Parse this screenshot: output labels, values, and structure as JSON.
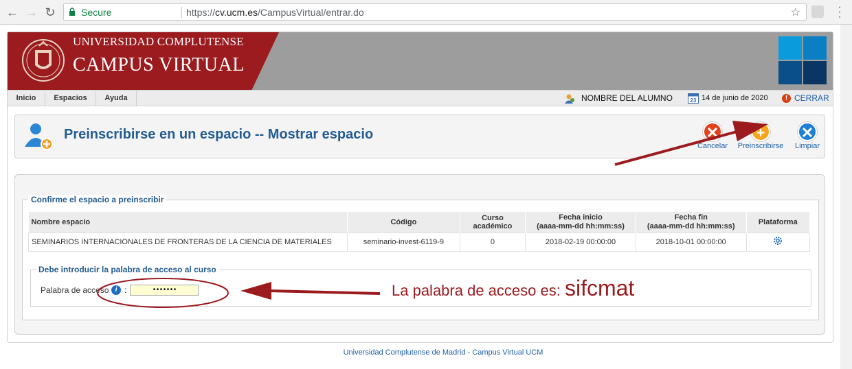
{
  "browser": {
    "secure_label": "Secure",
    "url_scheme": "https://",
    "url_host": "cv.ucm.es",
    "url_path": "/CampusVirtual/entrar.do"
  },
  "header": {
    "university": "UNIVERSIDAD COMPLUTENSE",
    "campus": "CAMPUS VIRTUAL",
    "tiles_colors": [
      "#0a9bdc",
      "#0b7fc4",
      "#0a4f87",
      "#0b3664"
    ],
    "brand_red": "#9b1b1f"
  },
  "navbar": {
    "items": [
      "Inicio",
      "Espacios",
      "Ayuda"
    ],
    "user_name": "NOMBRE DEL ALUMNO",
    "date": "14 de junio de 2020",
    "calendar_day": "23",
    "logout": "CERRAR"
  },
  "title_box": {
    "heading": "Preinscribirse en un espacio -- Mostrar espacio",
    "actions": {
      "cancel": "Cancelar",
      "preinscribe": "Preinscribirse",
      "clear": "Limpiar"
    }
  },
  "confirm": {
    "legend": "Confirme el espacio a preinscribir",
    "columns": {
      "name": "Nombre espacio",
      "code": "Código",
      "year": "Curso académico",
      "start_1": "Fecha inicio",
      "start_2": "(aaaa-mm-dd hh:mm:ss)",
      "end_1": "Fecha fin",
      "end_2": "(aaaa-mm-dd hh:mm:ss)",
      "platform": "Plataforma"
    },
    "row": {
      "name": "SEMINARIOS INTERNACIONALES DE FRONTERAS DE LA CIENCIA DE MATERIALES",
      "code": "seminario-invest-6119-9",
      "year": "0",
      "start": "2018-02-19 00:00:00",
      "end": "2018-10-01 00:00:00"
    }
  },
  "access": {
    "legend": "Debe introducir la palabra de acceso al curso",
    "label": "Palabra de acceso",
    "info": "i",
    "colon": ":",
    "value": "•••••••"
  },
  "annotation": {
    "hint_prefix": "La palabra de acceso es: ",
    "hint_code": "sifcmat"
  },
  "footer": {
    "text": "Universidad Complutense de Madrid - Campus Virtual UCM"
  }
}
